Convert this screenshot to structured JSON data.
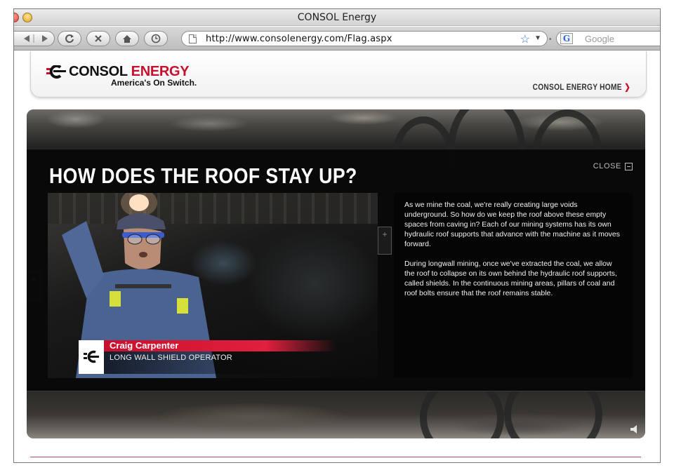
{
  "window": {
    "title": "CONSOL Energy"
  },
  "toolbar": {
    "url": "http://www.consolenergy.com/Flag.aspx",
    "search_placeholder": "Google",
    "search_engine_glyph": "G"
  },
  "header": {
    "logo_word_1": "CONSOL",
    "logo_word_2": "ENERGY",
    "tagline": "America's On Switch.",
    "home_link": "CONSOL ENERGY HOME",
    "home_arrow": "❯"
  },
  "overlay": {
    "heading": "HOW DOES THE ROOF STAY UP?",
    "close_label": "CLOSE",
    "speaker_name": "Craig Carpenter",
    "speaker_role": "LONG WALL SHIELD OPERATOR",
    "paragraphs": [
      "As we mine the coal, we're really creating large voids underground. So how do we keep the roof above these empty spaces from caving in? Each of our mining systems has its own hydraulic roof supports that advance with the machine as it moves forward.",
      "During longwall mining, once we've extracted the coal, we allow the roof to collapse on its own behind the hydraulic roof supports, called shields. In the continuous mining areas, pillars of coal and roof bolts ensure that the roof remains stable."
    ],
    "plus_glyph": "+"
  },
  "colors": {
    "brand_red": "#c8102e",
    "overlay_bg": "#080808"
  },
  "icons": {
    "back": "back-arrow-icon",
    "forward": "forward-arrow-icon",
    "reload": "reload-icon",
    "stop": "stop-icon",
    "home": "home-icon",
    "history": "clock-icon",
    "bookmark": "star-icon",
    "sound": "speaker-icon"
  }
}
